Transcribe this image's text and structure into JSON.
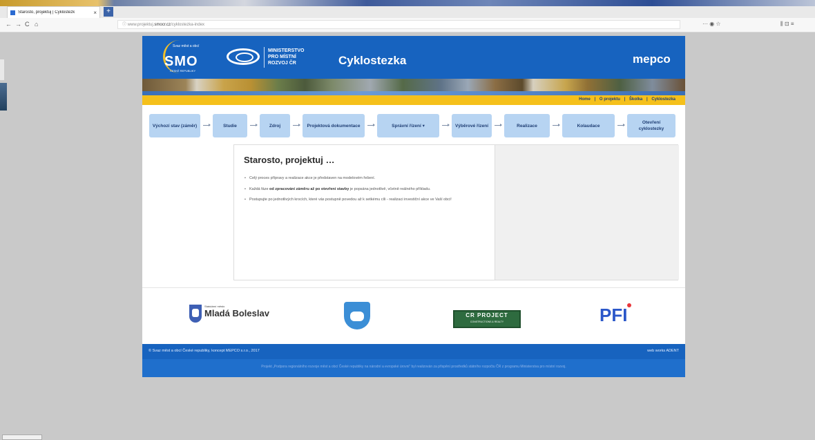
{
  "browser": {
    "tab_title": "Starosto, projektuj | Cyklostezk",
    "tab_close": "×",
    "new_tab": "+",
    "url_prefix": "www.projektuj.",
    "url_domain": "smocr.cz",
    "url_path": "/cyklostezka-index",
    "nav_back": "←",
    "nav_forward": "→",
    "nav_reload": "C",
    "nav_home": "⌂",
    "menu_icons": "··· ◉ ☆",
    "right_icons": "⫼ ⊡ ≡"
  },
  "header": {
    "smo_small": "Svaz měst a obcí",
    "smo_big": "SMO",
    "smo_sub": "ČESKÉ REPUBLIKY",
    "ministry_line1": "MINISTERSTVO",
    "ministry_line2": "PRO MÍSTNÍ",
    "ministry_line3": "ROZVOJ ČR",
    "site_title": "Cyklostezka",
    "mepco": "mepco"
  },
  "topnav": {
    "items": [
      "Home",
      "O projektu",
      "Školka",
      "Cyklostezka"
    ],
    "sep": "|"
  },
  "steps": [
    {
      "label": "Výchozí stav (záměr)"
    },
    {
      "label": "Studie"
    },
    {
      "label": "Zdroj"
    },
    {
      "label": "Projektová dokumentace"
    },
    {
      "label": "Správní řízení ▾"
    },
    {
      "label": "Výběrové řízení"
    },
    {
      "label": "Realizace"
    },
    {
      "label": "Kolaudace"
    },
    {
      "label": "Otevření cyklostezky"
    }
  ],
  "content": {
    "title": "Starosto, projektuj …",
    "bullet1": "Celý proces přípravy a realizace akce je představen na modelovém řešení.",
    "bullet2_pre": "Každá fáze ",
    "bullet2_bold": "od zpracování záměru až po otevření stavby",
    "bullet2_post": " je popsána jednotlivě, včetně reálného příkladu.",
    "bullet3": "Postupujte po jednotlivých krocích, které vás postupně povedou až k setkému cíli - realizaci investiční akce ve Vaší obci!"
  },
  "partners": {
    "mb_small": "Statutární město",
    "mb_name": "Mladá Boleslav",
    "crp_top": "CR PROJECT",
    "crp_bottom": "CONSTRUCTIONS & REALTY",
    "pfi": "PFI"
  },
  "footer": {
    "copyright": "© Svaz měst a obcí České republiky, koncept MEPCO s.r.o., 2017",
    "webworks": "web works ADENT",
    "note": "Projekt „Podpora regionálního rozvoje měst a obcí České republiky na národní a evropské úrovni“ byl realizován za přispění prostředků státního rozpočtu ČR z programu Ministerstva pro místní rozvoj."
  },
  "colors": {
    "header_blue": "#1763bf",
    "accent_yellow": "#f5c01b",
    "step_blue": "#b7d4f2",
    "step_text": "#1e3d73"
  }
}
